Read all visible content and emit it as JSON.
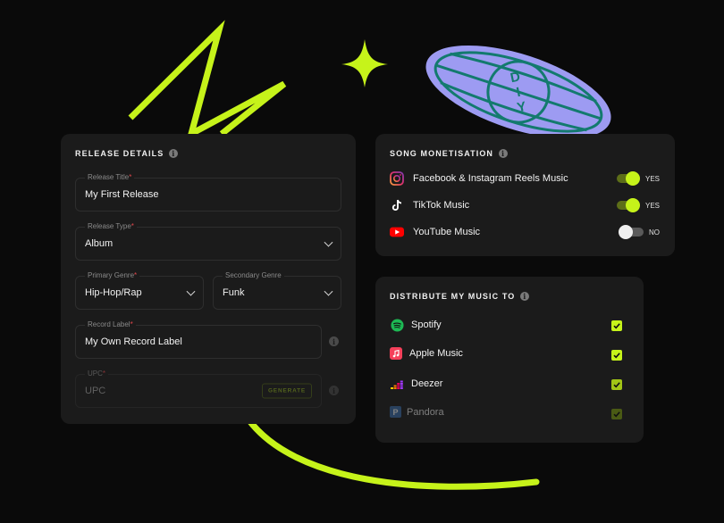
{
  "colors": {
    "accent": "#c6f31a",
    "card": "#1b1b1b",
    "background": "#0a0a0a",
    "badge": "#9d9bf2"
  },
  "badge": {
    "text": "DIY"
  },
  "release": {
    "title": "RELEASE DETAILS",
    "release_title": {
      "label": "Release Title",
      "required": "*",
      "value": "My First Release"
    },
    "release_type": {
      "label": "Release Type",
      "required": "*",
      "value": "Album"
    },
    "primary_genre": {
      "label": "Primary Genre",
      "required": "*",
      "value": "Hip-Hop/Rap"
    },
    "secondary_genre": {
      "label": "Secondary Genre",
      "value": "Funk"
    },
    "record_label": {
      "label": "Record Label",
      "required": "*",
      "value": "My Own Record Label"
    },
    "upc": {
      "label": "UPC",
      "required": "*",
      "placeholder": "UPC",
      "button": "GENERATE"
    }
  },
  "monetisation": {
    "title": "SONG MONETISATION",
    "items": [
      {
        "icon": "instagram-icon",
        "label": "Facebook & Instagram Reels Music",
        "on": true,
        "state": "YES"
      },
      {
        "icon": "tiktok-icon",
        "label": "TikTok Music",
        "on": true,
        "state": "YES"
      },
      {
        "icon": "youtube-icon",
        "label": "YouTube Music",
        "on": false,
        "state": "NO"
      }
    ]
  },
  "distribute": {
    "title": "DISTRIBUTE MY MUSIC TO",
    "items": [
      {
        "icon": "spotify-icon",
        "label": "Spotify",
        "checked": true
      },
      {
        "icon": "apple-music-icon",
        "label": "Apple Music",
        "checked": true
      },
      {
        "icon": "deezer-icon",
        "label": "Deezer",
        "checked": true
      },
      {
        "icon": "pandora-icon",
        "label": "Pandora",
        "checked": true
      }
    ]
  }
}
